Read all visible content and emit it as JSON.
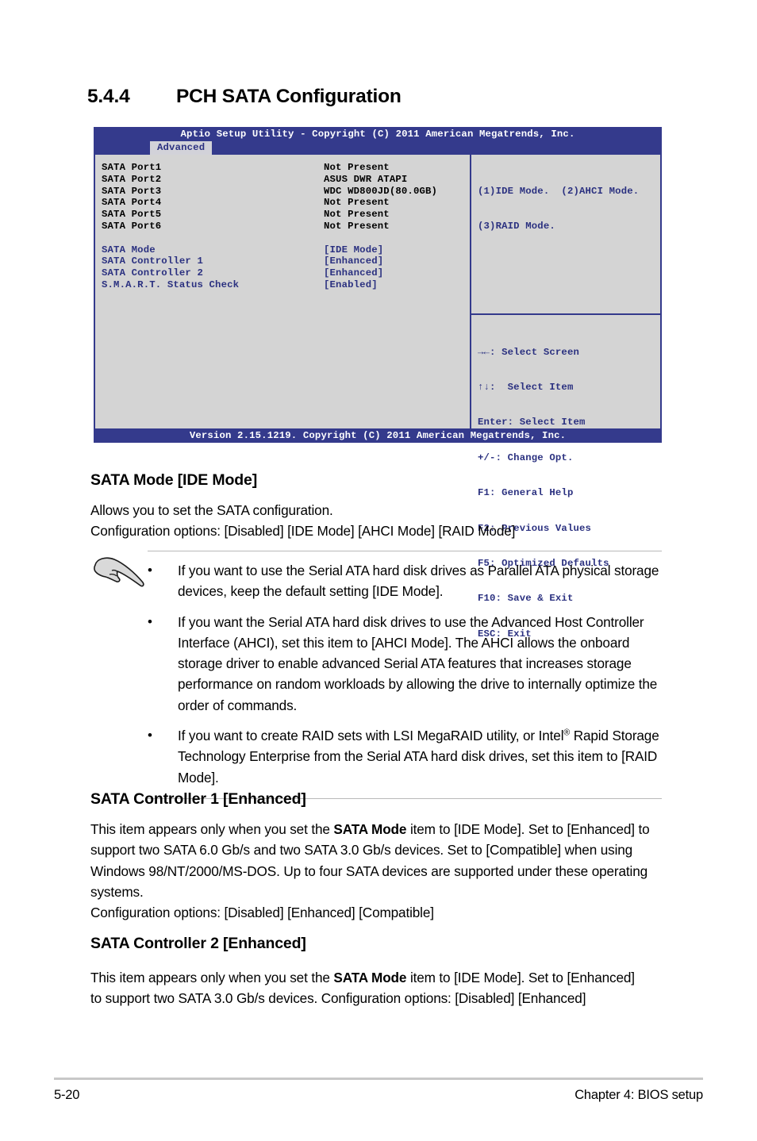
{
  "heading": {
    "number": "5.4.4",
    "title": "PCH SATA Configuration"
  },
  "bios": {
    "titlebar": "Aptio Setup Utility - Copyright (C) 2011 American Megatrends, Inc.",
    "tab": "Advanced",
    "ports": [
      {
        "label": "SATA Port1",
        "value": "Not Present"
      },
      {
        "label": "SATA Port2",
        "value": "ASUS DWR ATAPI"
      },
      {
        "label": "SATA Port3",
        "value": "WDC WD800JD(80.0GB)"
      },
      {
        "label": "SATA Port4",
        "value": "Not Present"
      },
      {
        "label": "SATA Port5",
        "value": "Not Present"
      },
      {
        "label": "SATA Port6",
        "value": "Not Present"
      }
    ],
    "settings": [
      {
        "label": "SATA Mode",
        "value": "[IDE Mode]"
      },
      {
        "label": "SATA Controller 1",
        "value": "[Enhanced]"
      },
      {
        "label": "SATA Controller 2",
        "value": "[Enhanced]"
      },
      {
        "label": "S.M.A.R.T. Status Check",
        "value": "[Enabled]"
      }
    ],
    "help_lines": [
      "(1)IDE Mode.  (2)AHCI Mode.",
      "(3)RAID Mode."
    ],
    "key_legend": [
      "→←: Select Screen",
      "↑↓:  Select Item",
      "Enter: Select Item",
      "+/-: Change Opt.",
      "F1: General Help",
      "F2: Previous Values",
      "F5: Optimized Defaults",
      "F10: Save & Exit",
      "ESC: Exit"
    ],
    "footer": "Version 2.15.1219. Copyright (C) 2011 American Megatrends, Inc.",
    "colors": {
      "header_blue": "#343a8c",
      "panel_gray": "#d4d4d4",
      "item_blue": "#2b3180",
      "tab_bg": "#d2d2d9"
    }
  },
  "sections": {
    "sata_mode": {
      "title": "SATA Mode [IDE Mode]",
      "line1": "Allows you to set the SATA configuration.",
      "line2": "Configuration options: [Disabled] [IDE Mode] [AHCI Mode] [RAID Mode]"
    },
    "notes": {
      "bullet": "•",
      "items": [
        "If you want to use the Serial ATA hard disk drives as Parallel ATA physical storage devices, keep the default setting [IDE Mode].",
        "If you want the Serial ATA hard disk drives to use the Advanced Host Controller Interface (AHCI), set this item to [AHCI Mode]. The AHCI allows the onboard storage driver to enable advanced Serial ATA features that increases storage performance on random workloads by allowing the drive to internally optimize the order of commands.",
        "If you want to create RAID sets with LSI MegaRAID utility, or Intel"
      ],
      "item3_part2": " Rapid Storage Technology Enterprise from the Serial ATA hard disk drives, set this item to [RAID Mode].",
      "registered_mark": "®"
    },
    "controller1": {
      "title": "SATA Controller 1 [Enhanced]",
      "body_a": "This item appears only when you set the ",
      "body_bold": "SATA Mode",
      "body_b": " item to [IDE Mode]. Set to [Enhanced] to support two SATA 6.0 Gb/s and two SATA 3.0 Gb/s devices. Set to [Compatible] when using Windows 98/NT/2000/MS-DOS. Up to four SATA devices are supported under these operating systems.",
      "options": "Configuration options: [Disabled] [Enhanced] [Compatible]"
    },
    "controller2": {
      "title": "SATA Controller 2 [Enhanced]",
      "body_a": "This item appears only when you set the ",
      "body_bold": "SATA Mode",
      "body_b": " item to [IDE Mode]. Set to [Enhanced] to support two SATA 3.0 Gb/s devices. Configuration options: [Disabled] [Enhanced]"
    }
  },
  "footer": {
    "page_number": "5-20",
    "chapter": "Chapter 4: BIOS setup"
  }
}
